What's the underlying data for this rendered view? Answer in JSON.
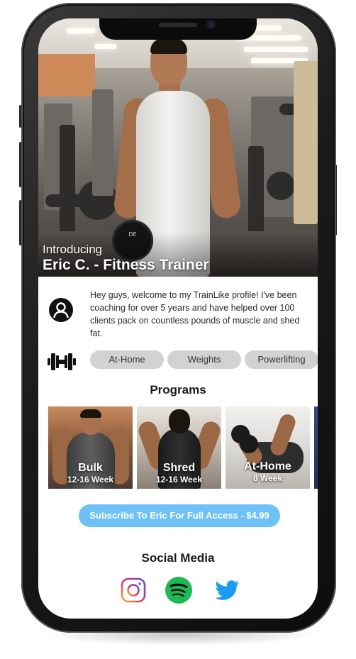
{
  "hero": {
    "kicker": "Introducing",
    "title": "Eric C. - Fitness Trainer",
    "dumbbell_text": "DE"
  },
  "bio": {
    "icon": "user-avatar-icon",
    "text": "Hey guys, welcome to my TrainLike profile! I've been coaching for over 5 years and have helped over 100 clients pack on countless pounds of muscle and shed fat."
  },
  "tags": {
    "icon": "dumbbell-icon",
    "items": [
      "At-Home",
      "Weights",
      "Powerlifting"
    ]
  },
  "programs": {
    "title": "Programs",
    "items": [
      {
        "name": "Bulk",
        "duration": "12-16 Week"
      },
      {
        "name": "Shred",
        "duration": "12-16 Week"
      },
      {
        "name": "At-Home",
        "duration": "8 Week"
      }
    ]
  },
  "subscribe": {
    "label": "Subscribe To Eric For Full Access - $4.99",
    "color": "#6ec1f6"
  },
  "social": {
    "title": "Social Media",
    "icons": [
      "instagram-icon",
      "spotify-icon",
      "twitter-icon"
    ],
    "colors": {
      "spotify": "#1db954",
      "twitter": "#1d9bf0"
    }
  }
}
